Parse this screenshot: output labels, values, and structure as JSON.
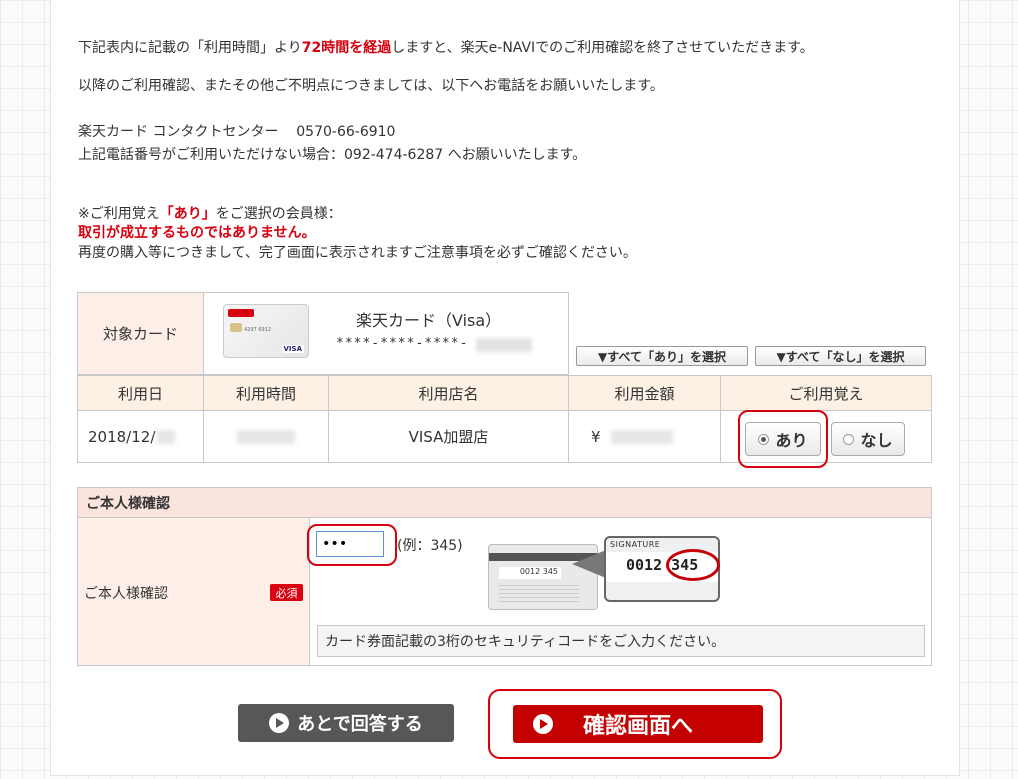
{
  "notice": {
    "line1_a": "下記表内に記載の「利用時間」より",
    "line1_b": "72時間を経過",
    "line1_c": "しますと、楽天e-NAVIでのご利用確認を終了させていただきます。",
    "line2": "以降のご利用確認、またその他ご不明点につきましては、以下へお電話をお願いいたします。",
    "contact_label": "楽天カード コンタクトセンター",
    "contact_phone": "0570-66-6910",
    "alt_line": "上記電話番号がご利用いただけない場合：092-474-6287 へお願いいたします。",
    "note_a": "※ご利用覚え",
    "note_b": "「あり」",
    "note_c": "をご選択の会員様：",
    "warning": "取引が成立するものではありません。",
    "repurchase": "再度の購入等につきまして、完了画面に表示されますご注意事項を必ずご確認ください。"
  },
  "card": {
    "label": "対象カード",
    "name": "楽天カード（Visa）",
    "number_masked": "****-****-****-"
  },
  "select_all": {
    "yes": "▼すべて「あり」を選択",
    "no": "▼すべて「なし」を選択"
  },
  "table": {
    "headers": [
      "利用日",
      "利用時間",
      "利用店名",
      "利用金額",
      "ご利用覚え"
    ],
    "rows": [
      {
        "date": "2018/12/",
        "time": "",
        "store": "VISA加盟店",
        "amount": "¥",
        "recognition": "あり"
      }
    ],
    "option_yes": "あり",
    "option_no": "なし"
  },
  "identity": {
    "section_title": "ご本人様確認",
    "row_label": "ご本人様確認",
    "required": "必須",
    "input_value": "•••",
    "example": "(例：345)",
    "card_sig_text": "0012 345",
    "zoom_label": "SIGNATURE",
    "zoom_code": "0012 345",
    "instruction": "カード券面記載の3桁のセキュリティコードをご入力ください。"
  },
  "buttons": {
    "later": "あとで回答する",
    "confirm": "確認画面へ"
  },
  "colors": {
    "accent_red": "#d7000f",
    "button_gray": "#575757",
    "button_red": "#c40000"
  }
}
